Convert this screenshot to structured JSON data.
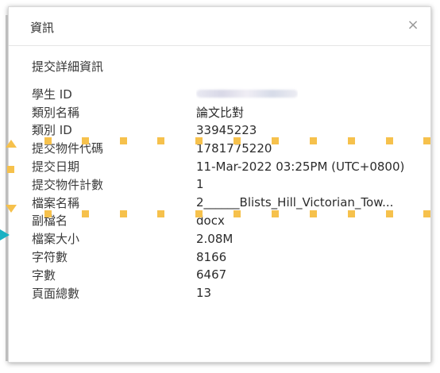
{
  "dialog": {
    "title": "資訊",
    "close_label": "×"
  },
  "section": {
    "title": "提交詳細資訊"
  },
  "details": [
    {
      "label": "學生 ID",
      "value": ""
    },
    {
      "label": "類別名稱",
      "value": "論文比對"
    },
    {
      "label": "類別 ID",
      "value": "33945223"
    },
    {
      "label": "提交物件代碼",
      "value": "1781775220"
    },
    {
      "label": "提交日期",
      "value": "11-Mar-2022 03:25PM (UTC+0800)"
    },
    {
      "label": "提交物件計數",
      "value": "1"
    },
    {
      "label": "檔案名稱",
      "value": "2______Blists_Hill_Victorian_Tow..."
    },
    {
      "label": "副檔名",
      "value": "docx"
    },
    {
      "label": "檔案大小",
      "value": "2.08M"
    },
    {
      "label": "字符數",
      "value": "8166"
    },
    {
      "label": "字數",
      "value": "6467"
    },
    {
      "label": "頁面總數",
      "value": "13"
    }
  ]
}
